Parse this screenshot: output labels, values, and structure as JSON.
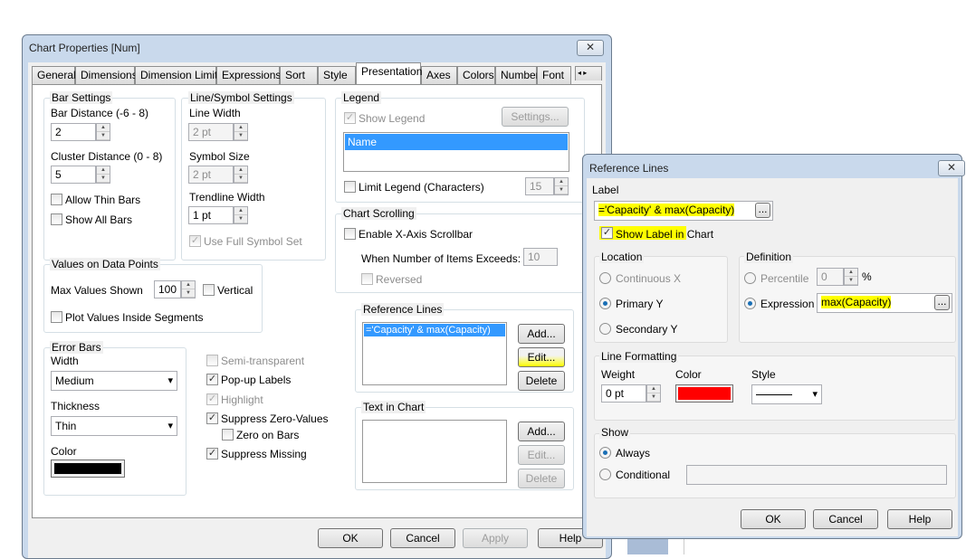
{
  "main": {
    "title": "Chart Properties [Num]",
    "tabs": [
      "General",
      "Dimensions",
      "Dimension Limits",
      "Expressions",
      "Sort",
      "Style",
      "Presentation",
      "Axes",
      "Colors",
      "Number",
      "Font"
    ],
    "active_tab": "Presentation",
    "bar_settings": {
      "title": "Bar Settings",
      "bar_distance_label": "Bar Distance (-6 - 8)",
      "bar_distance": "2",
      "cluster_distance_label": "Cluster Distance (0 - 8)",
      "cluster_distance": "5",
      "allow_thin": "Allow Thin Bars",
      "show_all": "Show All Bars"
    },
    "line_symbol": {
      "title": "Line/Symbol Settings",
      "line_width_label": "Line Width",
      "line_width": "2 pt",
      "symbol_size_label": "Symbol Size",
      "symbol_size": "2 pt",
      "trendline_label": "Trendline Width",
      "trendline": "1 pt",
      "full_symbol": "Use Full Symbol Set"
    },
    "legend": {
      "title": "Legend",
      "show": "Show Legend",
      "settings": "Settings...",
      "items": [
        "Name"
      ],
      "limit": "Limit Legend (Characters)",
      "limit_value": "15"
    },
    "scrolling": {
      "title": "Chart Scrolling",
      "enable": "Enable X-Axis Scrollbar",
      "when": "When Number of Items Exceeds:",
      "value": "10",
      "reversed": "Reversed"
    },
    "values": {
      "title": "Values on Data Points",
      "max_label": "Max Values Shown",
      "max": "100",
      "vertical": "Vertical",
      "inside": "Plot Values Inside Segments"
    },
    "error_bars": {
      "title": "Error Bars",
      "width_label": "Width",
      "width": "Medium",
      "thickness_label": "Thickness",
      "thickness": "Thin",
      "color_label": "Color",
      "color": "#000000"
    },
    "options": {
      "semi": "Semi-transparent",
      "popup": "Pop-up Labels",
      "highlight": "Highlight",
      "suppress_zero": "Suppress Zero-Values",
      "zero_bars": "Zero on Bars",
      "suppress_missing": "Suppress Missing"
    },
    "ref_lines": {
      "title": "Reference Lines",
      "items": [
        "='Capacity' & max(Capacity)"
      ],
      "add": "Add...",
      "edit": "Edit...",
      "delete": "Delete"
    },
    "text_in_chart": {
      "title": "Text in Chart",
      "add": "Add...",
      "edit": "Edit...",
      "delete": "Delete"
    },
    "buttons": {
      "ok": "OK",
      "cancel": "Cancel",
      "apply": "Apply",
      "help": "Help"
    }
  },
  "ref": {
    "title": "Reference Lines",
    "label_title": "Label",
    "label_value": "='Capacity' & max(Capacity)",
    "browse": "...",
    "show_label": "Show Label in Chart",
    "location": {
      "title": "Location",
      "continuous": "Continuous X",
      "primary": "Primary Y",
      "secondary": "Secondary Y"
    },
    "definition": {
      "title": "Definition",
      "percentile": "Percentile",
      "percentile_value": "0",
      "percent": "%",
      "expression": "Expression",
      "expression_value": "max(Capacity)"
    },
    "formatting": {
      "title": "Line Formatting",
      "weight_label": "Weight",
      "weight": "0 pt",
      "color_label": "Color",
      "color": "#ff0000",
      "style_label": "Style"
    },
    "show": {
      "title": "Show",
      "always": "Always",
      "conditional": "Conditional"
    },
    "buttons": {
      "ok": "OK",
      "cancel": "Cancel",
      "help": "Help"
    }
  }
}
